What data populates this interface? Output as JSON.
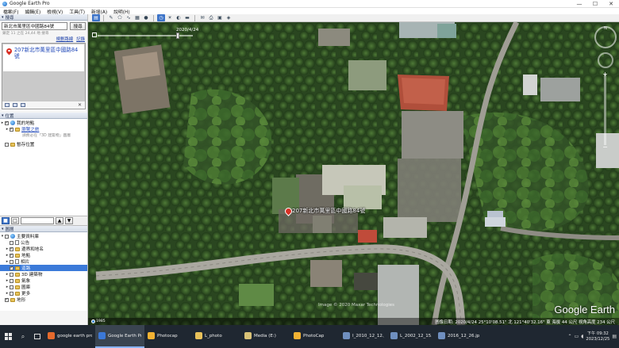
{
  "window": {
    "title": "Google Earth Pro",
    "controls": [
      "—",
      "☐",
      "✕"
    ]
  },
  "menu": [
    "檔案(F)",
    "編輯(E)",
    "檢視(V)",
    "工具(T)",
    "新增(A)",
    "說明(H)"
  ],
  "search": {
    "header": "搜尋",
    "value": "新北市萬里區中國路84號",
    "button": "搜尋",
    "hint": "鎖定 11 之在 24,44 地 搜尋",
    "links": [
      "規劃路線",
      "記錄"
    ],
    "result": "207新北市萬里區中國路84號"
  },
  "places": {
    "header": "位置",
    "items": [
      {
        "label": "我的地點",
        "icon": "globe-icon",
        "expander": "▸",
        "checked": true,
        "indent": 0
      },
      {
        "label": "瀏覽之旅",
        "icon": "folder-icon",
        "expander": "▸",
        "checked": true,
        "indent": 1,
        "link": true
      },
      {
        "label": "暫存位置",
        "icon": "folder-icon",
        "expander": "",
        "checked": false,
        "indent": 0
      }
    ],
    "sublabel": "請務必在「3D 建築物」圖層"
  },
  "layers": {
    "header": "圖層",
    "items": [
      {
        "label": "主要資料庫",
        "expander": "▾",
        "checked": false,
        "indent": 0,
        "icon": "globe-icon",
        "selected": false
      },
      {
        "label": "公告",
        "expander": "",
        "checked": false,
        "indent": 1,
        "icon": "doc-icon",
        "selected": false
      },
      {
        "label": "邊界和地名",
        "expander": "▸",
        "checked": true,
        "indent": 1,
        "icon": "flag-icon",
        "selected": false
      },
      {
        "label": "地點",
        "expander": "▸",
        "checked": true,
        "indent": 1,
        "icon": "folder-icon",
        "selected": false
      },
      {
        "label": "相片",
        "expander": "▸",
        "checked": false,
        "indent": 1,
        "icon": "photo-icon",
        "selected": false
      },
      {
        "label": "道路",
        "expander": "",
        "checked": true,
        "indent": 1,
        "icon": "road-icon",
        "selected": true
      },
      {
        "label": "3D 建築物",
        "expander": "▸",
        "checked": false,
        "indent": 1,
        "icon": "building-icon",
        "selected": false
      },
      {
        "label": "氣象",
        "expander": "▸",
        "checked": false,
        "indent": 1,
        "icon": "weather-icon",
        "selected": false
      },
      {
        "label": "圖庫",
        "expander": "▸",
        "checked": false,
        "indent": 1,
        "icon": "folder-icon",
        "selected": false
      },
      {
        "label": "更多",
        "expander": "▸",
        "checked": false,
        "indent": 1,
        "icon": "folder-icon",
        "selected": false
      },
      {
        "label": "地形",
        "expander": "",
        "checked": true,
        "indent": 0,
        "icon": "terrain-icon",
        "selected": false
      }
    ]
  },
  "toolbar": {
    "buttons": [
      "sidebar",
      "placemark",
      "polygon",
      "path",
      "overlay",
      "record-tour",
      "historical-imagery",
      "sun",
      "planets",
      "ruler",
      "email",
      "print",
      "save-image",
      "maps"
    ],
    "active": [
      "sidebar",
      "historical-imagery"
    ]
  },
  "map": {
    "time_label": "2020/4/24",
    "placemark_label": "207新北市萬里區中國路84號",
    "attribution": "Image © 2020 Maxar Technologies",
    "logo": "Google Earth",
    "year": "1985",
    "status": "圖像日期: 2020/4/24    25°10'08.51\" 北  121°40'32.16\" 東  海拔  44 公尺    視角高度  234 公尺"
  },
  "taskbar": {
    "items": [
      {
        "label": "google earth pro...",
        "color": "#e66a2c",
        "active": false
      },
      {
        "label": "Google Earth Pro",
        "color": "#3b78d8",
        "active": true
      },
      {
        "label": "Photocap",
        "color": "#f2b233",
        "active": false
      },
      {
        "label": "L_photo",
        "color": "#e8c15a",
        "active": false
      },
      {
        "label": "Media (E:)",
        "color": "#d9c277",
        "active": false
      },
      {
        "label": "PhotoCap",
        "color": "#f2b233",
        "active": false
      },
      {
        "label": "I_2010_12_12.jpg -...",
        "color": "#6f8fbf",
        "active": false
      },
      {
        "label": "L_2002_12_15.jpg...",
        "color": "#6f8fbf",
        "active": false
      },
      {
        "label": "2016_12_26.jpg -...",
        "color": "#6f8fbf",
        "active": false
      }
    ],
    "time": "下午 09:32",
    "date": "2023/12/25"
  }
}
